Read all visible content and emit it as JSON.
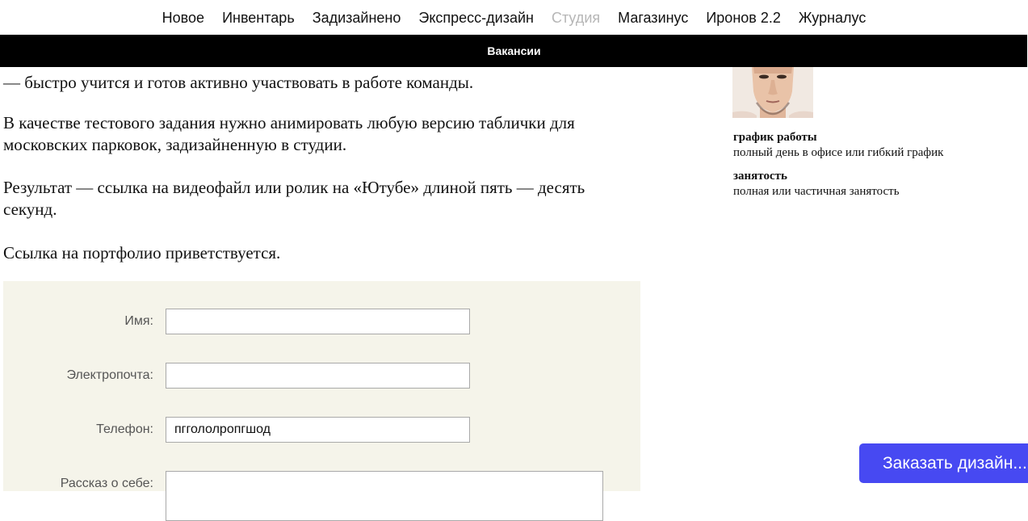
{
  "nav": {
    "items": [
      {
        "label": "Новое"
      },
      {
        "label": "Инвентарь"
      },
      {
        "label": "Задизайнено"
      },
      {
        "label": "Экспресс-дизайн"
      },
      {
        "label": "Студия",
        "active": true
      },
      {
        "label": "Магазинус"
      },
      {
        "label": "Иронов 2.2"
      },
      {
        "label": "Журналус"
      }
    ]
  },
  "subnav": {
    "label": "Вакансии"
  },
  "article": {
    "p1": "— быстро учится и готов активно участвовать в работе команды.",
    "p2": "В качестве тестового задания нужно анимировать любую версию таблички для московских парковок, задизайненную в студии.",
    "p3": "Результат — ссылка на видеофайл или ролик на «Ютубе» длиной пять — десять секунд.",
    "p4": "Ссылка на портфолио приветствуется."
  },
  "form": {
    "name_label": "Имя:",
    "name_value": "",
    "email_label": "Электропочта:",
    "email_value": "",
    "phone_label": "Телефон:",
    "phone_value": "пггололропгшод",
    "about_label": "Рассказ о себе:"
  },
  "sidebar": {
    "schedule_label": "график работы",
    "schedule_value": "полный день в офисе или гибкий график",
    "employment_label": "занятость",
    "employment_value": "полная или частичная занятость"
  },
  "order_button": {
    "label": "Заказать дизайн..."
  },
  "colors": {
    "accent": "#4749f2",
    "form_bg": "#f5f4ea",
    "nav_muted": "#b6b6b6",
    "bar": "#000000"
  }
}
